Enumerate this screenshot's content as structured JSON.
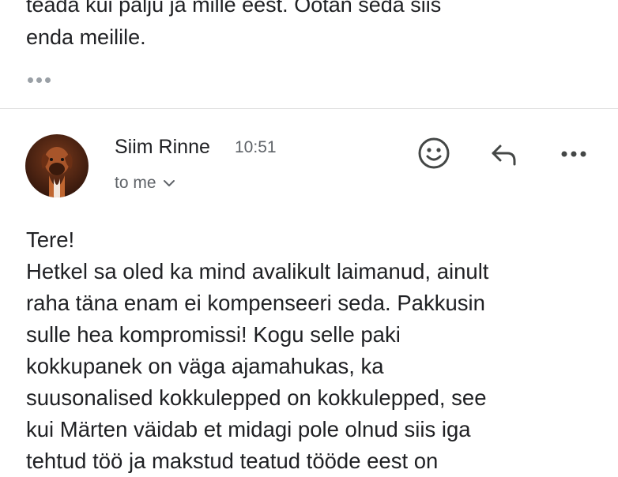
{
  "previous_message": {
    "lines": [
      "teada kui palju ja mille eest. Ootan seda siis",
      "enda meilile."
    ]
  },
  "message": {
    "sender": "Siim Rinne",
    "time": "10:51",
    "recipient": "to me",
    "body_lines": [
      "Tere!",
      "Hetkel sa oled ka mind avalikult laimanud, ainult",
      "raha täna enam ei kompenseeri seda. Pakkusin",
      "sulle hea kompromissi! Kogu selle paki",
      "kokkupanek on väga ajamahukas, ka",
      "suusonalised kokkulepped on kokkulepped, see",
      "kui Märten väidab et midagi pole olnud siis iga",
      "tehtud töö ja makstud teatud tööde eest on"
    ]
  },
  "icons": {
    "show_quoted": "more-horizontal-icon",
    "emoji": "emoji-smile-icon",
    "reply": "reply-arrow-icon",
    "more": "more-horizontal-icon",
    "recipient_toggle": "chevron-down-icon"
  }
}
